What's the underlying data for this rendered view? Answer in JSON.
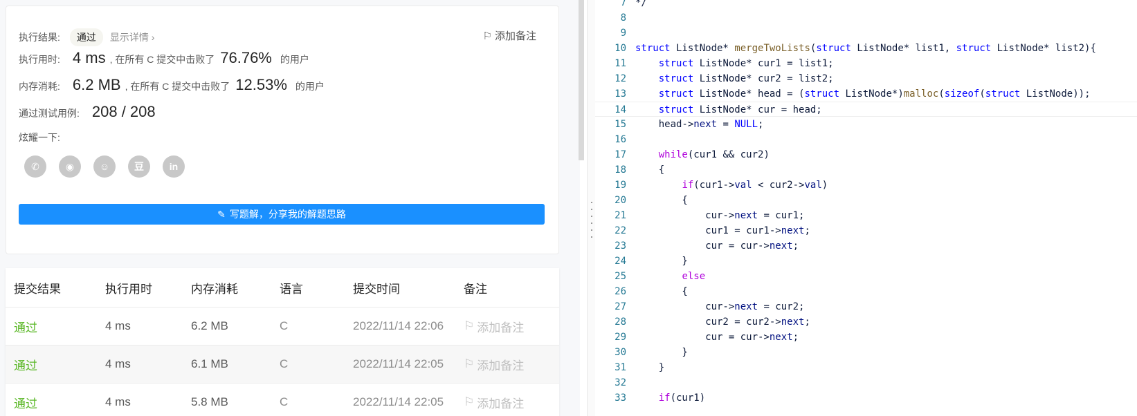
{
  "result": {
    "label": "执行结果:",
    "status": "通过",
    "details": "显示详情 ›",
    "add_note": "添加备注",
    "runtime_label": "执行用时:",
    "runtime_value": "4 ms",
    "runtime_text": ", 在所有 C 提交中击败了",
    "runtime_pct": "76.76%",
    "runtime_suffix": "的用户",
    "memory_label": "内存消耗:",
    "memory_value": "6.2 MB",
    "memory_text": ", 在所有 C 提交中击败了",
    "memory_pct": "12.53%",
    "memory_suffix": "的用户",
    "tests_label": "通过测试用例:",
    "tests_value": "208 / 208",
    "share_label": "炫耀一下:",
    "share_icons": [
      "wechat-icon",
      "weibo-icon",
      "qq-icon",
      "douban-icon",
      "linkedin-icon"
    ],
    "share_glyphs": [
      "✆",
      "◉",
      "☺",
      "豆",
      "in"
    ],
    "write_button": "写题解，分享我的解题思路"
  },
  "table": {
    "headers": [
      "提交结果",
      "执行用时",
      "内存消耗",
      "语言",
      "提交时间",
      "备注"
    ],
    "rows": [
      {
        "status": "通过",
        "time": "4 ms",
        "memory": "6.2 MB",
        "lang": "C",
        "submitted": "2022/11/14 22:06",
        "note": "添加备注"
      },
      {
        "status": "通过",
        "time": "4 ms",
        "memory": "6.1 MB",
        "lang": "C",
        "submitted": "2022/11/14 22:05",
        "note": "添加备注"
      },
      {
        "status": "通过",
        "time": "4 ms",
        "memory": "5.8 MB",
        "lang": "C",
        "submitted": "2022/11/14 22:05",
        "note": "添加备注"
      }
    ]
  },
  "code": {
    "current_line": 14,
    "lines": [
      {
        "n": "7",
        "t": "*/"
      },
      {
        "n": "8",
        "t": ""
      },
      {
        "n": "9",
        "t": ""
      },
      {
        "n": "10",
        "t": "struct ListNode* mergeTwoLists(struct ListNode* list1, struct ListNode* list2){"
      },
      {
        "n": "11",
        "t": "    struct ListNode* cur1 = list1;"
      },
      {
        "n": "12",
        "t": "    struct ListNode* cur2 = list2;"
      },
      {
        "n": "13",
        "t": "    struct ListNode* head = (struct ListNode*)malloc(sizeof(struct ListNode));"
      },
      {
        "n": "14",
        "t": "    struct ListNode* cur = head;"
      },
      {
        "n": "15",
        "t": "    head->next = NULL;"
      },
      {
        "n": "16",
        "t": ""
      },
      {
        "n": "17",
        "t": "    while(cur1 && cur2)"
      },
      {
        "n": "18",
        "t": "    {"
      },
      {
        "n": "19",
        "t": "        if(cur1->val < cur2->val)"
      },
      {
        "n": "20",
        "t": "        {"
      },
      {
        "n": "21",
        "t": "            cur->next = cur1;"
      },
      {
        "n": "22",
        "t": "            cur1 = cur1->next;"
      },
      {
        "n": "23",
        "t": "            cur = cur->next;"
      },
      {
        "n": "24",
        "t": "        }"
      },
      {
        "n": "25",
        "t": "        else"
      },
      {
        "n": "26",
        "t": "        {"
      },
      {
        "n": "27",
        "t": "            cur->next = cur2;"
      },
      {
        "n": "28",
        "t": "            cur2 = cur2->next;"
      },
      {
        "n": "29",
        "t": "            cur = cur->next;"
      },
      {
        "n": "30",
        "t": "        }"
      },
      {
        "n": "31",
        "t": "    }"
      },
      {
        "n": "32",
        "t": ""
      },
      {
        "n": "33",
        "t": "    if(cur1)"
      }
    ]
  },
  "colors": {
    "accent": "#1a90ff",
    "success": "#5ab726",
    "keyword": "#0000ff",
    "control": "#af00db"
  }
}
